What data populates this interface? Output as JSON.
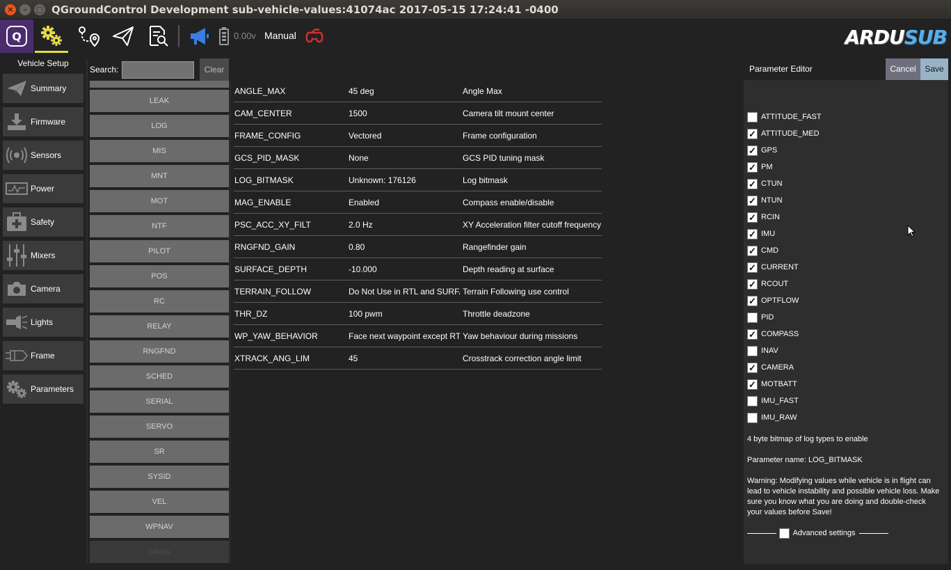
{
  "window": {
    "title": "QGroundControl Development sub-vehicle-values:41074ac 2017-05-15 17:24:41 -0400",
    "close_glyph": "×",
    "min_glyph": "–",
    "max_glyph": "□"
  },
  "toolbar": {
    "voltage": "0.00v",
    "flight_mode": "Manual",
    "brand_part1": "ARDU",
    "brand_part2": "SUB",
    "accent_color": "#e7d94a",
    "qgc_color": "#4b2d6d"
  },
  "vehicle_setup": {
    "title": "Vehicle Setup",
    "items": [
      {
        "label": "Summary",
        "icon": "paper-plane-icon"
      },
      {
        "label": "Firmware",
        "icon": "download-icon"
      },
      {
        "label": "Sensors",
        "icon": "radar-icon"
      },
      {
        "label": "Power",
        "icon": "power-graph-icon"
      },
      {
        "label": "Safety",
        "icon": "first-aid-icon"
      },
      {
        "label": "Mixers",
        "icon": "sliders-icon"
      },
      {
        "label": "Camera",
        "icon": "camera-icon"
      },
      {
        "label": "Lights",
        "icon": "flashlight-icon"
      },
      {
        "label": "Frame",
        "icon": "frame-icon"
      },
      {
        "label": "Parameters",
        "icon": "gears-icon"
      }
    ]
  },
  "search": {
    "label": "Search:",
    "value": "",
    "clear_label": "Clear"
  },
  "groups": [
    "LEAK",
    "LOG",
    "MIS",
    "MNT",
    "MOT",
    "NTF",
    "PILOT",
    "POS",
    "RC",
    "RELAY",
    "RNGFND",
    "SCHED",
    "SERIAL",
    "SERVO",
    "SR",
    "SYSID",
    "VEL",
    "WPNAV",
    "others"
  ],
  "params": [
    {
      "name": "ANGLE_MAX",
      "value": "45 deg",
      "desc": "Angle Max"
    },
    {
      "name": "CAM_CENTER",
      "value": "1500",
      "desc": "Camera tilt mount center"
    },
    {
      "name": "FRAME_CONFIG",
      "value": "Vectored",
      "desc": "Frame configuration"
    },
    {
      "name": "GCS_PID_MASK",
      "value": "None",
      "desc": "GCS PID tuning mask"
    },
    {
      "name": "LOG_BITMASK",
      "value": "Unknown: 176126",
      "desc": "Log bitmask"
    },
    {
      "name": "MAG_ENABLE",
      "value": "Enabled",
      "desc": "Compass enable/disable"
    },
    {
      "name": "PSC_ACC_XY_FILT",
      "value": "2.0 Hz",
      "desc": "XY Acceleration filter cutoff frequency"
    },
    {
      "name": "RNGFND_GAIN",
      "value": "0.80",
      "desc": "Rangefinder gain"
    },
    {
      "name": "SURFACE_DEPTH",
      "value": "-10.000",
      "desc": "Depth reading at surface"
    },
    {
      "name": "TERRAIN_FOLLOW",
      "value": "Do Not Use in RTL and SURFACE",
      "desc": "Terrain Following use control"
    },
    {
      "name": "THR_DZ",
      "value": "100 pwm",
      "desc": "Throttle deadzone"
    },
    {
      "name": "WP_YAW_BEHAVIOR",
      "value": "Face next waypoint except RTL",
      "desc": "Yaw behaviour during missions"
    },
    {
      "name": "XTRACK_ANG_LIM",
      "value": "45",
      "desc": "Crosstrack correction angle limit"
    }
  ],
  "editor": {
    "title": "Parameter Editor",
    "cancel_label": "Cancel",
    "save_label": "Save",
    "bits": [
      {
        "label": "ATTITUDE_FAST",
        "checked": false
      },
      {
        "label": "ATTITUDE_MED",
        "checked": true
      },
      {
        "label": "GPS",
        "checked": true
      },
      {
        "label": "PM",
        "checked": true
      },
      {
        "label": "CTUN",
        "checked": true
      },
      {
        "label": "NTUN",
        "checked": true
      },
      {
        "label": "RCIN",
        "checked": true
      },
      {
        "label": "IMU",
        "checked": true
      },
      {
        "label": "CMD",
        "checked": true
      },
      {
        "label": "CURRENT",
        "checked": true
      },
      {
        "label": "RCOUT",
        "checked": true
      },
      {
        "label": "OPTFLOW",
        "checked": true
      },
      {
        "label": "PID",
        "checked": false
      },
      {
        "label": "COMPASS",
        "checked": true
      },
      {
        "label": "INAV",
        "checked": false
      },
      {
        "label": "CAMERA",
        "checked": true
      },
      {
        "label": "MOTBATT",
        "checked": true
      },
      {
        "label": "IMU_FAST",
        "checked": false
      },
      {
        "label": "IMU_RAW",
        "checked": false
      }
    ],
    "description": "4 byte bitmap of log types to enable",
    "param_name": "Parameter name: LOG_BITMASK",
    "warning": "Warning: Modifying values while vehicle is in flight can lead to vehicle instability and possible vehicle loss. Make sure you know what you are doing and double-check your values before Save!",
    "advanced_label": "Advanced settings",
    "advanced_checked": false,
    "check_glyph": "✓"
  }
}
